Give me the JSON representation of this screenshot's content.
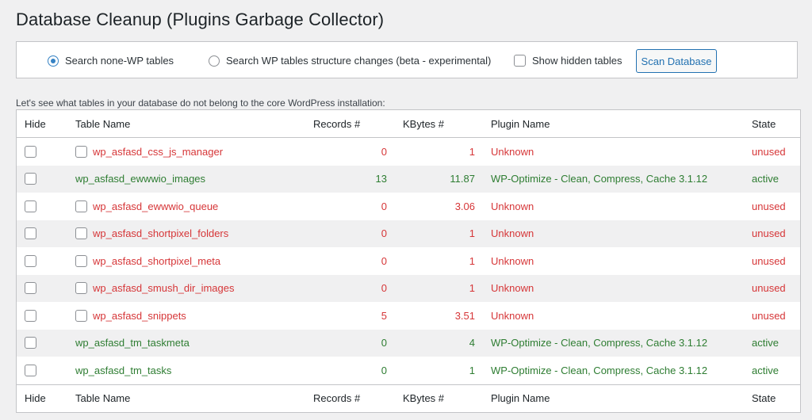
{
  "page_title": "Database Cleanup (Plugins Garbage Collector)",
  "options": {
    "radio_none_wp": "Search none-WP tables",
    "radio_wp_structure": "Search WP tables structure changes (beta - experimental)",
    "show_hidden": "Show hidden tables",
    "scan_button": "Scan Database"
  },
  "intro_text": "Let's see what tables in your database do not belong to the core WordPress installation:",
  "columns": {
    "hide": "Hide",
    "table_name": "Table Name",
    "records": "Records #",
    "kbytes": "KBytes #",
    "plugin": "Plugin Name",
    "state": "State"
  },
  "rows": [
    {
      "name": "wp_asfasd_css_js_manager",
      "records": "0",
      "kbytes": "1",
      "plugin": "Unknown",
      "state": "unused"
    },
    {
      "name": "wp_asfasd_ewwwio_images",
      "records": "13",
      "kbytes": "11.87",
      "plugin": "WP-Optimize - Clean, Compress, Cache 3.1.12",
      "state": "active"
    },
    {
      "name": "wp_asfasd_ewwwio_queue",
      "records": "0",
      "kbytes": "3.06",
      "plugin": "Unknown",
      "state": "unused"
    },
    {
      "name": "wp_asfasd_shortpixel_folders",
      "records": "0",
      "kbytes": "1",
      "plugin": "Unknown",
      "state": "unused"
    },
    {
      "name": "wp_asfasd_shortpixel_meta",
      "records": "0",
      "kbytes": "1",
      "plugin": "Unknown",
      "state": "unused"
    },
    {
      "name": "wp_asfasd_smush_dir_images",
      "records": "0",
      "kbytes": "1",
      "plugin": "Unknown",
      "state": "unused"
    },
    {
      "name": "wp_asfasd_snippets",
      "records": "5",
      "kbytes": "3.51",
      "plugin": "Unknown",
      "state": "unused"
    },
    {
      "name": "wp_asfasd_tm_taskmeta",
      "records": "0",
      "kbytes": "4",
      "plugin": "WP-Optimize - Clean, Compress, Cache 3.1.12",
      "state": "active"
    },
    {
      "name": "wp_asfasd_tm_tasks",
      "records": "0",
      "kbytes": "1",
      "plugin": "WP-Optimize - Clean, Compress, Cache 3.1.12",
      "state": "active"
    }
  ],
  "colors": {
    "unused": "#d63638",
    "active": "#2e7d32",
    "accent": "#2271b1"
  }
}
